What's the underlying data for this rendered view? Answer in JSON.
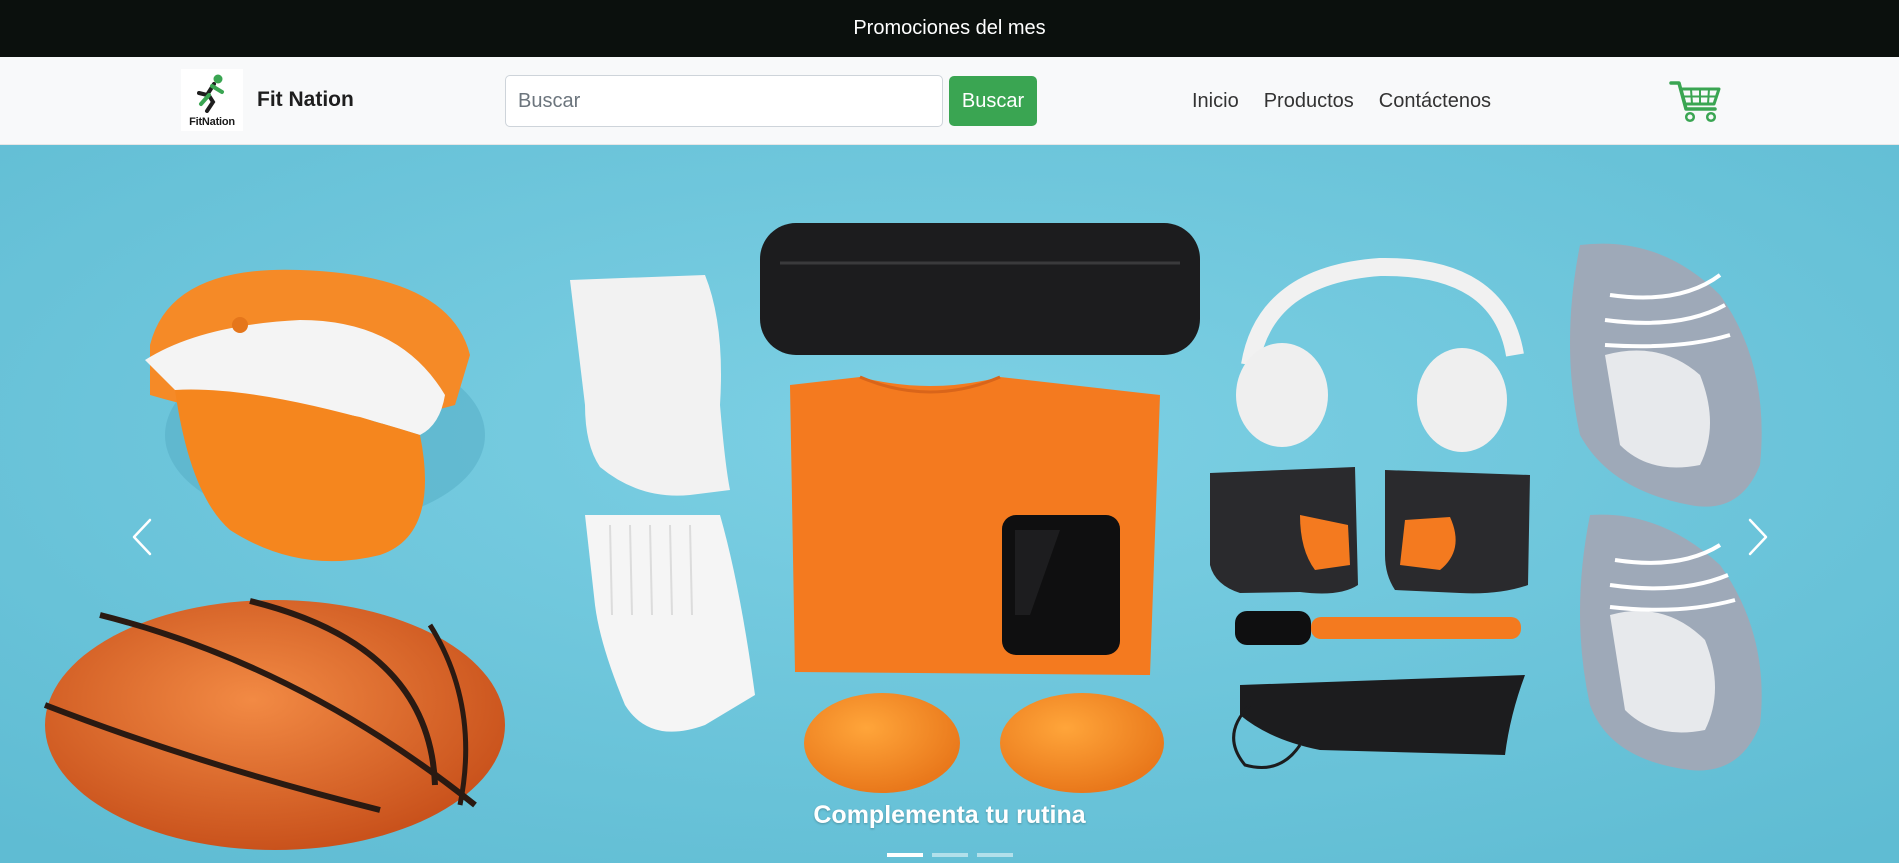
{
  "promo": {
    "text": "Promociones del mes"
  },
  "navbar": {
    "brand_logo_text": "FitNation",
    "brand_name": "Fit Nation",
    "search": {
      "placeholder": "Buscar",
      "value": "",
      "button_label": "Buscar"
    },
    "links": [
      {
        "label": "Inicio"
      },
      {
        "label": "Productos"
      },
      {
        "label": "Contáctenos"
      }
    ],
    "cart_icon": "shopping-cart-icon"
  },
  "hero": {
    "caption": "Complementa tu rutina",
    "slide_count": 3,
    "active_slide": 1,
    "prev_icon": "chevron-left-icon",
    "next_icon": "chevron-right-icon"
  },
  "colors": {
    "promo_background": "#0b100d",
    "navbar_background": "#f8f9fa",
    "accent_green": "#3aa552",
    "hero_background": "#6fc7dd",
    "product_orange": "#f47a1f"
  }
}
